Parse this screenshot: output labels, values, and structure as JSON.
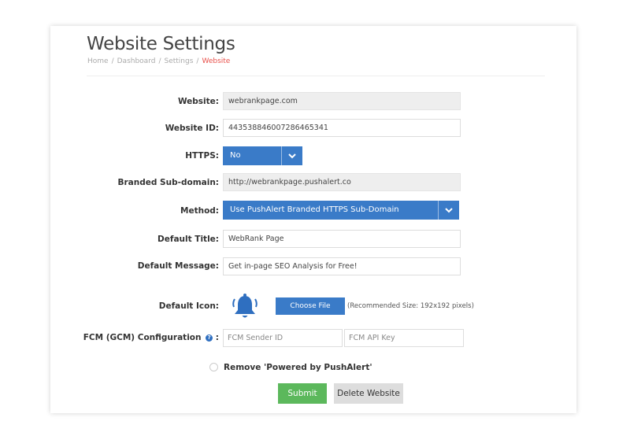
{
  "header": {
    "title": "Website Settings",
    "breadcrumb": [
      "Home",
      "Dashboard",
      "Settings",
      "Website"
    ]
  },
  "form": {
    "website": {
      "label": "Website:",
      "value": "webrankpage.com"
    },
    "website_id": {
      "label": "Website ID:",
      "value": "443538846007286465341"
    },
    "https": {
      "label": "HTTPS:",
      "value": "No"
    },
    "subdomain": {
      "label": "Branded Sub-domain:",
      "value": "http://webrankpage.pushalert.co"
    },
    "method": {
      "label": "Method:",
      "value": "Use PushAlert Branded HTTPS Sub-Domain"
    },
    "default_title": {
      "label": "Default Title:",
      "value": "WebRank Page"
    },
    "default_message": {
      "label": "Default Message:",
      "value": "Get in-page SEO Analysis for Free!"
    },
    "default_icon": {
      "label": "Default Icon:",
      "button": "Choose File",
      "hint": "(Recommended Size: 192x192 pixels)"
    },
    "fcm": {
      "label": "FCM (GCM) Configuration",
      "suffix": ":",
      "sender_placeholder": "FCM Sender ID",
      "api_placeholder": "FCM API Key"
    },
    "remove_powered": {
      "label": "Remove 'Powered by PushAlert'"
    }
  },
  "actions": {
    "submit": "Submit",
    "delete": "Delete Website"
  },
  "colors": {
    "primary": "#3a7bc8",
    "success": "#5cb85c",
    "breadcrumb_active": "#e8504a"
  }
}
